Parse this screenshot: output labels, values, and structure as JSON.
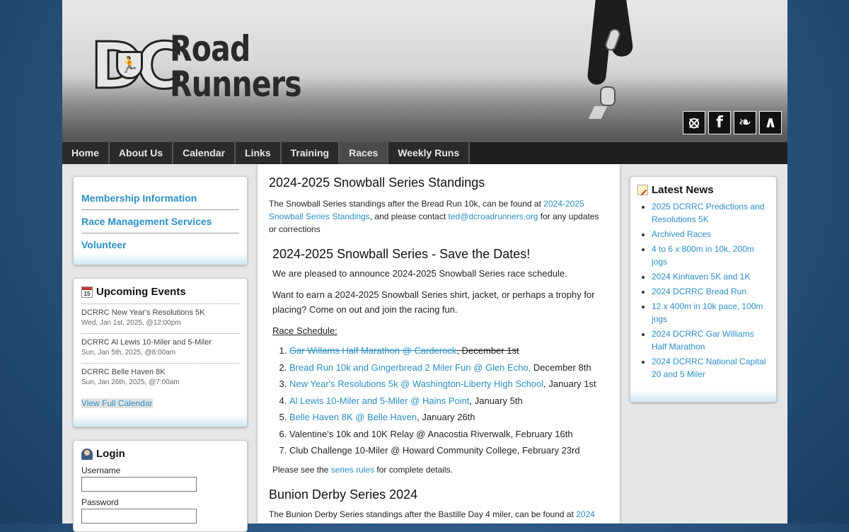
{
  "header": {
    "logo_letters": "DC",
    "logo_line1": "Road",
    "logo_line2": "Runners",
    "social": [
      {
        "icon": "rss-icon",
        "glyph": "⦻"
      },
      {
        "icon": "facebook-icon",
        "glyph": "f"
      },
      {
        "icon": "twitter-icon",
        "glyph": "❧"
      },
      {
        "icon": "strava-icon",
        "glyph": "∧"
      }
    ]
  },
  "nav": {
    "items": [
      "Home",
      "About Us",
      "Calendar",
      "Links",
      "Training",
      "Races",
      "Weekly Runs"
    ],
    "active": "Races"
  },
  "sidebar": {
    "membership": [
      "Membership Information",
      "Race Management Services",
      "Volunteer"
    ],
    "events_title": "Upcoming Events",
    "calendar_glyph": "15",
    "events": [
      {
        "title": "DCRRC New Year's Resolutions 5K",
        "date": "Wed, Jan 1st, 2025, @12:00pm"
      },
      {
        "title": "DCRRC Al Lewis 10-Miler and 5-Miler",
        "date": "Sun, Jan 5th, 2025, @8:00am"
      },
      {
        "title": "DCRRC Belle Haven 8K",
        "date": "Sun, Jan 26th, 2025, @7:00am"
      }
    ],
    "view_calendar": "View Full Calendar",
    "login_title": "Login",
    "username_label": "Username",
    "password_label": "Password"
  },
  "main": {
    "standings_title": "2024-2025 Snowball Series Standings",
    "standings_p1": "The Snowball Series standings after the Bread Run 10k, can be found at ",
    "standings_link": "2024-2025 Snowball Series Standings",
    "standings_p2": ", and please contact ",
    "standings_email": "ted@dcroadrunners.org",
    "standings_p3": " for any updates or corrections",
    "save_title": "2024-2025 Snowball Series - Save the Dates!",
    "announce": "We are pleased to announce 2024-2025 Snowball Series race schedule.",
    "earn": "Want to earn a 2024-2025 Snowball Series shirt, jacket, or perhaps a trophy for placing? Come on out and join the racing fun.",
    "schedule_label": "Race Schedule:",
    "races": [
      {
        "link": "Gar Willams Half Marathon @ Carderock",
        "text": ", December 1st"
      },
      {
        "link": "Bread Run 10k and Gingerbread 2 Miler Fun @ Glen Echo,",
        "text": " December 8th"
      },
      {
        "link": "New Year's Resolutions 5k @ Washington-Liberty High School",
        "text": ", January 1st"
      },
      {
        "link": "Al Lewis 10-Miler and 5-Miler @ Hains Point",
        "text": ", January 5th"
      },
      {
        "link": "Belle Haven 8K @ Belle Haven",
        "text": ", January 26th"
      },
      {
        "link": "",
        "text": "Valentine's 10k and 10K Relay @ Anacostia Riverwalk, February 16th"
      },
      {
        "link": "",
        "text": "Club Challenge 10-Miler @ Howard Community College, February 23rd"
      }
    ],
    "rules_p1": "Please see the ",
    "rules_link": "series rules",
    "rules_p2": " for complete details.",
    "bunion_title": "Bunion Derby Series 2024",
    "bunion_p1": "The Bunion Derby Series standings after the Bastille Day 4 miler, can be found at ",
    "bunion_link": "2024"
  },
  "news": {
    "title": "Latest News",
    "items": [
      "2025 DCRRC Predictions and Resolutions 5K",
      "Archived Races",
      "4 to 6 x 800m in 10k, 200m jogs",
      "2024 Kinhaven 5K and 1K",
      "2024 DCRRC Bread Run",
      "12 x 400m in 10k pace, 100m jogs",
      "2024 DCRRC Gar Williams Half Marathon",
      "2024 DCRRC National Capital 20 and 5 Miler"
    ]
  }
}
